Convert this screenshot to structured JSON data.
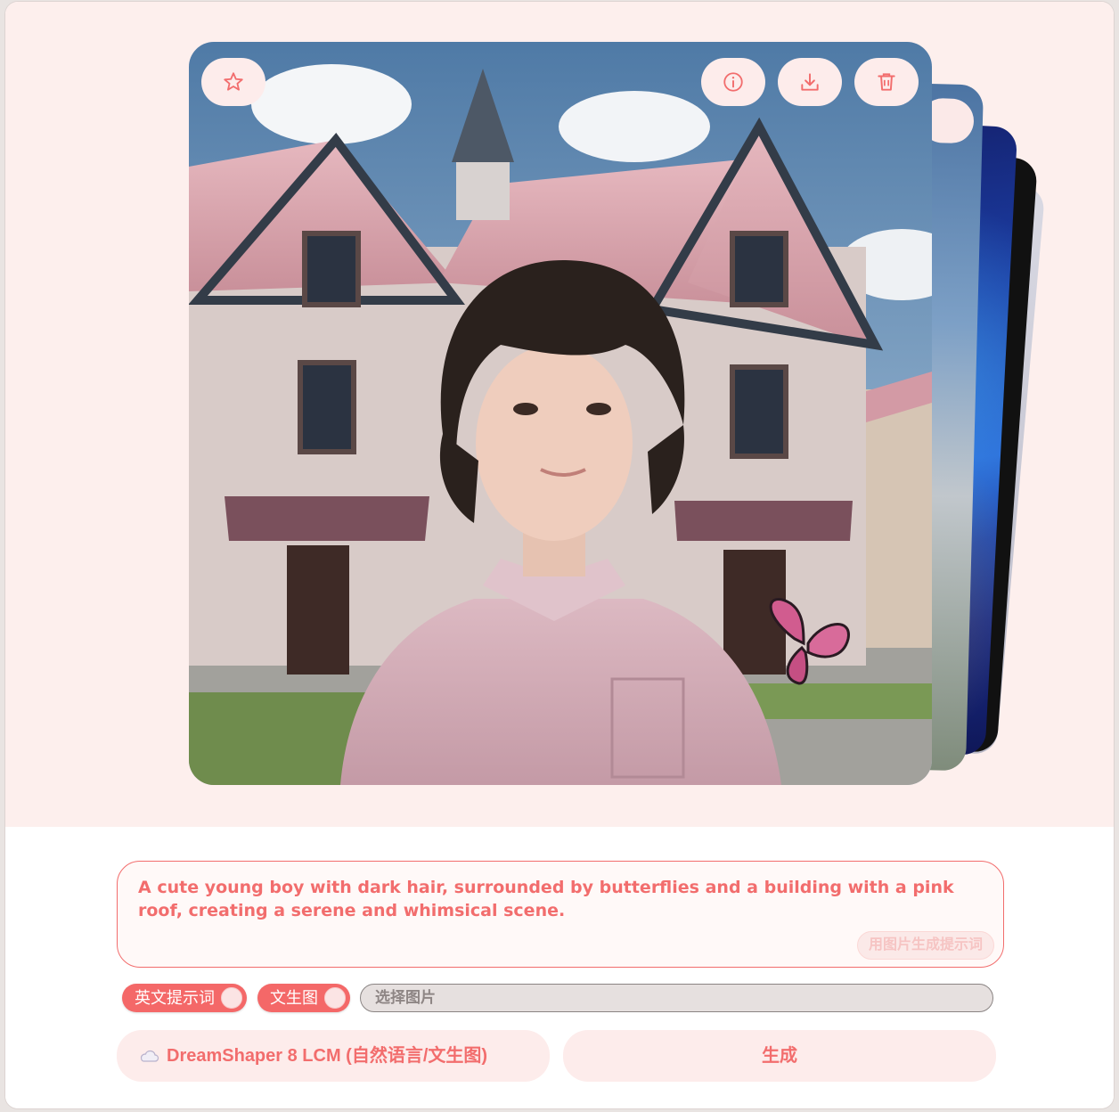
{
  "prompt": {
    "text": "A cute young boy with dark hair, surrounded by butterflies and a building with a pink roof, creating a serene and whimsical scene.",
    "image_to_prompt_label": "用图片生成提示词"
  },
  "toggles": {
    "english_prompt_label": "英文提示词",
    "text_to_image_label": "文生图"
  },
  "file_picker": {
    "placeholder": "选择图片"
  },
  "model": {
    "name": "DreamShaper 8 LCM (自然语言/文生图)"
  },
  "generate_label": "生成",
  "image_actions": [
    "favorite",
    "info",
    "download",
    "delete"
  ],
  "icons": {
    "favorite": "star-icon",
    "info": "info-icon",
    "download": "download-icon",
    "delete": "trash-icon",
    "model": "cloud-icon"
  },
  "colors": {
    "accent": "#f26d6d",
    "gallery_bg": "#fdefed",
    "button_bg": "#fdeceb"
  }
}
